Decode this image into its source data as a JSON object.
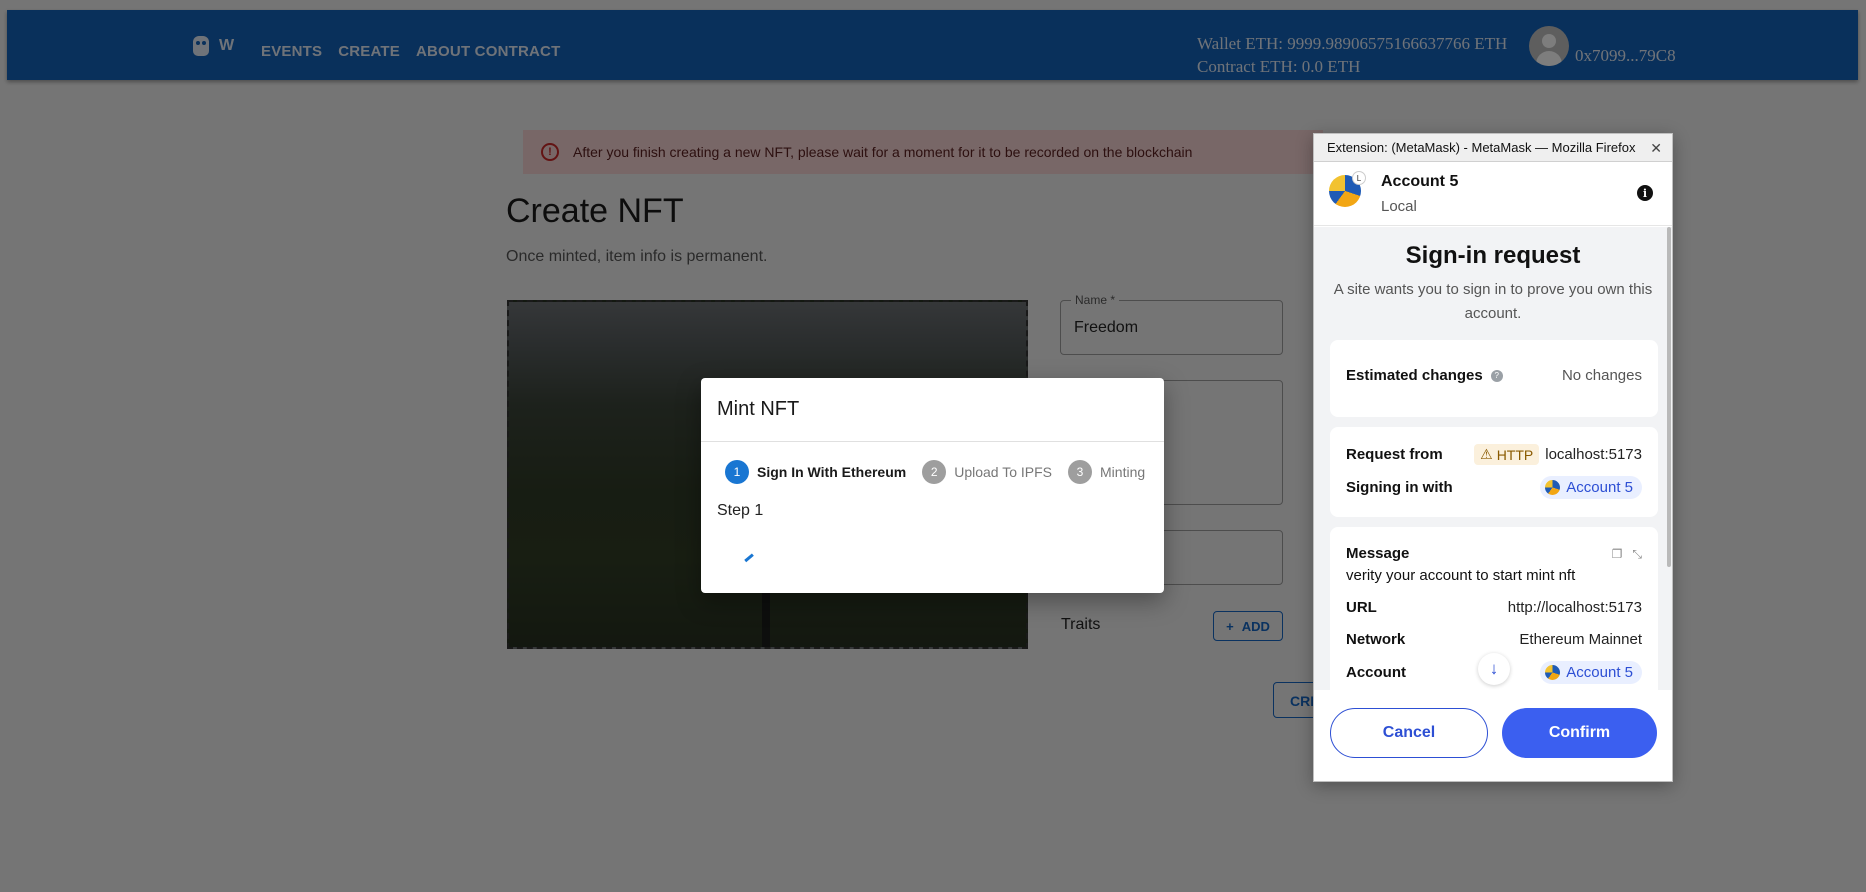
{
  "appbar": {
    "logo_text": "W",
    "nav": [
      "EVENTS",
      "CREATE",
      "ABOUT CONTRACT"
    ],
    "wallet_eth": "Wallet ETH: 9999.98906575166637766 ETH",
    "contract_eth": "Contract ETH: 0.0 ETH",
    "address": "0x7099...79C8"
  },
  "page": {
    "alert": "After you finish creating a new NFT, please wait for a moment for it to be recorded on the blockchain",
    "title": "Create NFT",
    "subtitle": "Once minted, item info is permanent.",
    "name_label": "Name *",
    "name_value": "Freedom",
    "traits_label": "Traits",
    "add_label": "ADD",
    "create_label": "CREATE"
  },
  "modal": {
    "title": "Mint NFT",
    "steps": [
      {
        "num": "1",
        "label": "Sign In With Ethereum"
      },
      {
        "num": "2",
        "label": "Upload To IPFS"
      },
      {
        "num": "3",
        "label": "Minting"
      }
    ],
    "active_step": 1,
    "step_text": "Step 1"
  },
  "metamask": {
    "window_title": "Extension: (MetaMask) - MetaMask — Mozilla Firefox",
    "account_name": "Account 5",
    "account_sub": "Local",
    "avatar_badge": "L",
    "heading": "Sign-in request",
    "description": "A site wants you to sign in to prove you own this account.",
    "estimated_changes_label": "Estimated changes",
    "estimated_changes_value": "No changes",
    "request_from_label": "Request from",
    "http_badge": "HTTP",
    "request_from_value": "localhost:5173",
    "signing_in_with_label": "Signing in with",
    "signing_account": "Account 5",
    "message_label": "Message",
    "message_value": "verity your account to start mint nft",
    "url_label": "URL",
    "url_value": "http://localhost:5173",
    "network_label": "Network",
    "network_value": "Ethereum Mainnet",
    "account_label": "Account",
    "account_value": "Account 5",
    "cancel_label": "Cancel",
    "confirm_label": "Confirm"
  },
  "colors": {
    "appbar": "#1360b6",
    "step_active": "#1976d2",
    "metamask_primary": "#3b5ff0"
  }
}
